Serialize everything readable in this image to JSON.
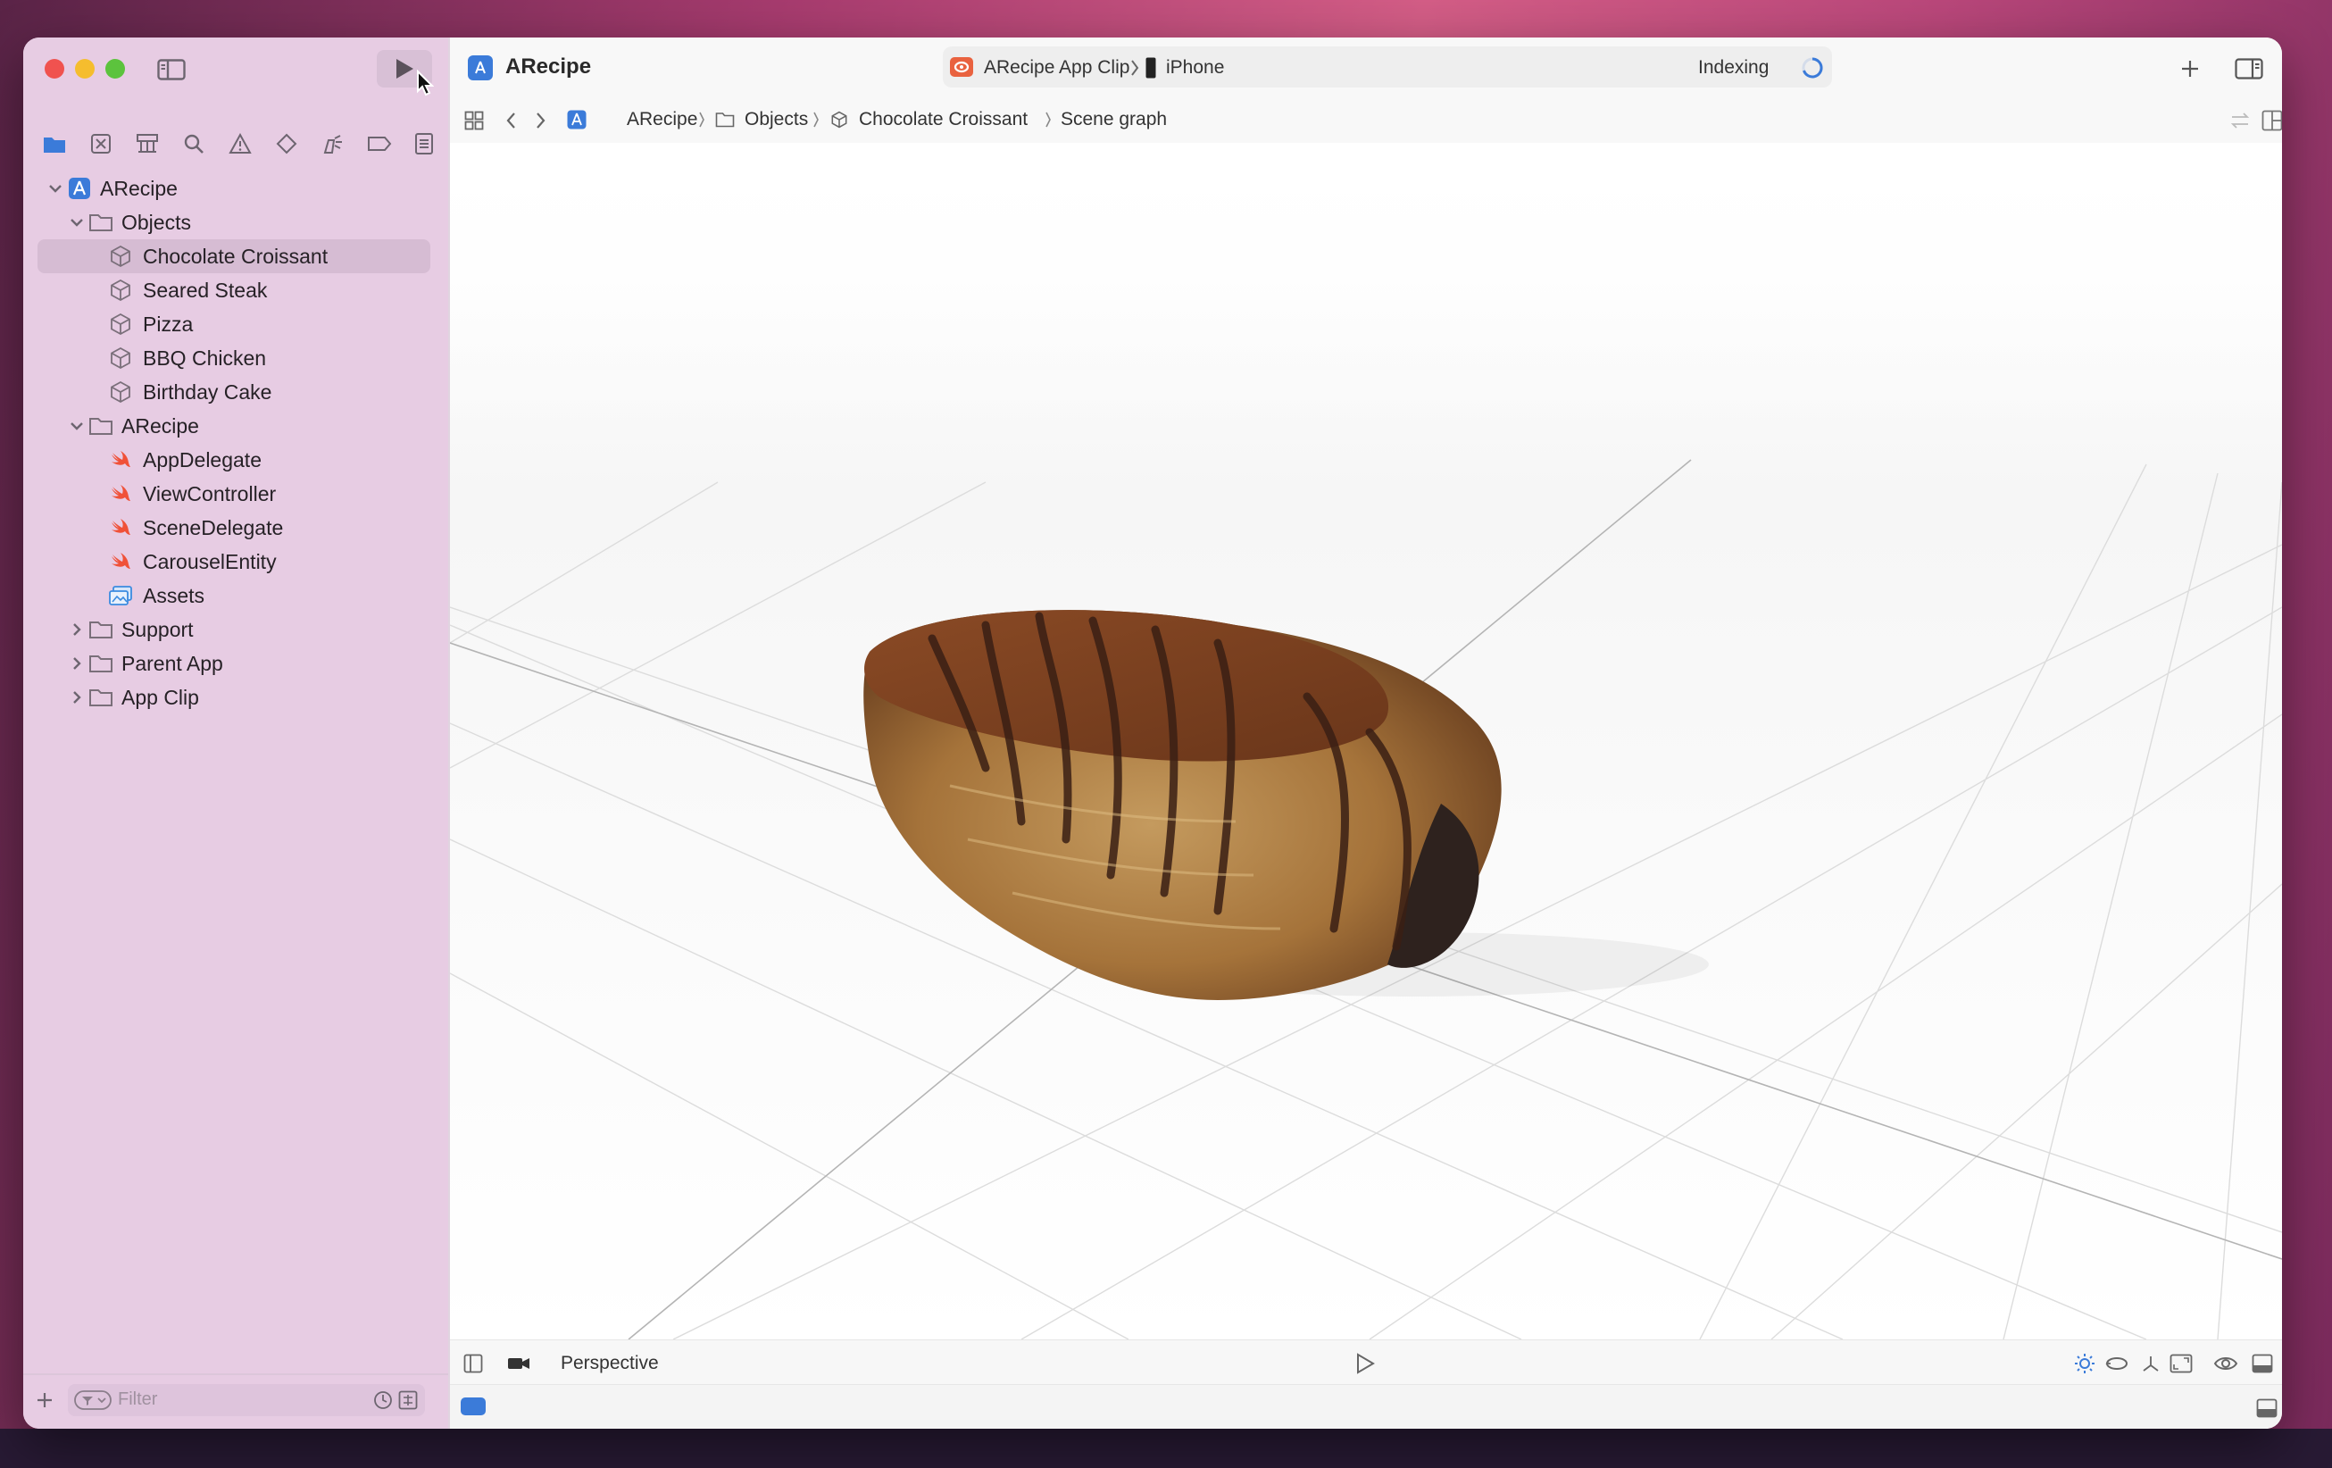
{
  "window": {
    "title": "ARecipe"
  },
  "navigator": {
    "tabs": [
      "project-navigator",
      "source-control-navigator",
      "symbol-navigator",
      "find-navigator",
      "issue-navigator",
      "test-navigator",
      "debug-navigator",
      "breakpoint-navigator",
      "report-navigator"
    ],
    "tree": [
      {
        "label": "ARecipe",
        "level": 0,
        "icon": "app-project-icon",
        "expanded": true
      },
      {
        "label": "Objects",
        "level": 1,
        "icon": "folder-icon",
        "expanded": true
      },
      {
        "label": "Chocolate Croissant",
        "level": 2,
        "icon": "3d-object-icon",
        "selected": true
      },
      {
        "label": "Seared Steak",
        "level": 2,
        "icon": "3d-object-icon"
      },
      {
        "label": "Pizza",
        "level": 2,
        "icon": "3d-object-icon"
      },
      {
        "label": "BBQ Chicken",
        "level": 2,
        "icon": "3d-object-icon"
      },
      {
        "label": "Birthday Cake",
        "level": 2,
        "icon": "3d-object-icon"
      },
      {
        "label": "ARecipe",
        "level": 1,
        "icon": "folder-icon",
        "expanded": true
      },
      {
        "label": "AppDelegate",
        "level": 2,
        "icon": "swift-file-icon"
      },
      {
        "label": "ViewController",
        "level": 2,
        "icon": "swift-file-icon"
      },
      {
        "label": "SceneDelegate",
        "level": 2,
        "icon": "swift-file-icon"
      },
      {
        "label": "CarouselEntity",
        "level": 2,
        "icon": "swift-file-icon"
      },
      {
        "label": "Assets",
        "level": 2,
        "icon": "asset-catalog-icon"
      },
      {
        "label": "Support",
        "level": 1,
        "icon": "folder-icon",
        "expanded": false
      },
      {
        "label": "Parent App",
        "level": 1,
        "icon": "folder-icon",
        "expanded": false
      },
      {
        "label": "App Clip",
        "level": 1,
        "icon": "folder-icon",
        "expanded": false
      }
    ],
    "filter_placeholder": "Filter"
  },
  "toolbar": {
    "project_title": "ARecipe",
    "scheme_name": "ARecipe App Clip",
    "destination": "iPhone",
    "status": "Indexing"
  },
  "jumpbar": {
    "crumbs": [
      "ARecipe",
      "Objects",
      "Chocolate Croissant",
      "Scene graph"
    ]
  },
  "viewport": {
    "camera_mode": "Perspective"
  },
  "colors": {
    "sidebar_bg": "#e7cce3",
    "selection": "#d6bcd3",
    "accent": "#3b7bd9",
    "swift": "#f05138"
  }
}
